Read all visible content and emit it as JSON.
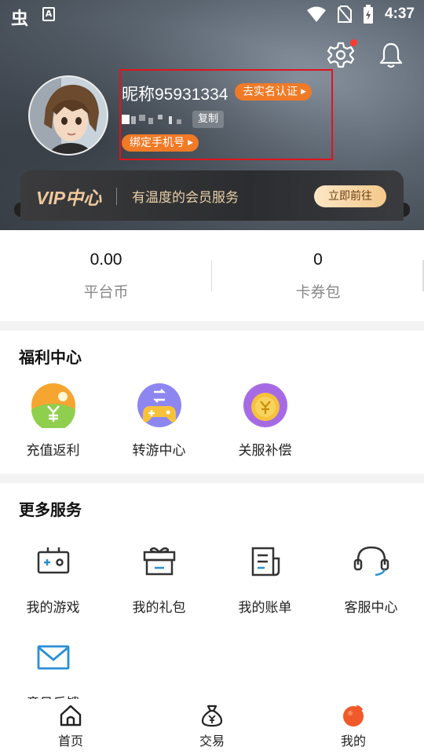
{
  "status_bar": {
    "app_logo": "虫",
    "notification_icon": "A",
    "time": "4:37"
  },
  "profile": {
    "nickname": "昵称95931334",
    "verify_label": "去实名认证",
    "copy_label": "复制",
    "bind_phone_label": "绑定手机号"
  },
  "vip": {
    "title": "VIP中心",
    "description": "有温度的会员服务",
    "button_label": "立即前往"
  },
  "wallet": [
    {
      "value": "0.00",
      "label": "平台币"
    },
    {
      "value": "0",
      "label": "卡券包"
    }
  ],
  "welfare": {
    "title": "福利中心",
    "items": [
      {
        "label": "充值返利",
        "icon": "recharge-rebate-icon"
      },
      {
        "label": "转游中心",
        "icon": "game-transfer-icon"
      },
      {
        "label": "关服补偿",
        "icon": "server-compensation-icon"
      }
    ]
  },
  "more_services": {
    "title": "更多服务",
    "items": [
      {
        "label": "我的游戏",
        "icon": "gamepad-icon"
      },
      {
        "label": "我的礼包",
        "icon": "gift-icon"
      },
      {
        "label": "我的账单",
        "icon": "bill-icon"
      },
      {
        "label": "客服中心",
        "icon": "headset-icon"
      },
      {
        "label": "意见反馈",
        "icon": "mail-icon"
      }
    ]
  },
  "bottom_nav": [
    {
      "label": "首页",
      "icon": "home-icon"
    },
    {
      "label": "交易",
      "icon": "money-bag-icon"
    },
    {
      "label": "我的",
      "icon": "profile-icon",
      "active": true
    }
  ],
  "colors": {
    "accent": "#f07a26",
    "blue": "#2a8fd6",
    "vip_gold": "#f0c99c"
  }
}
